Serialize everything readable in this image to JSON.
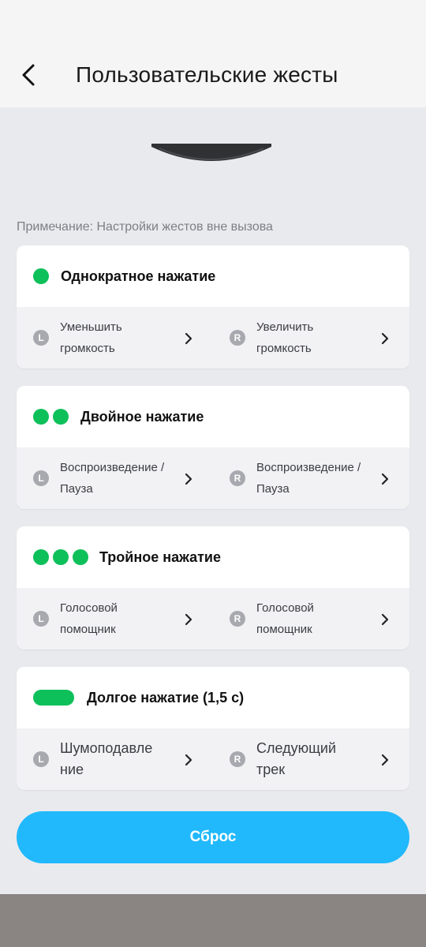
{
  "header": {
    "title": "Пользовательские жесты"
  },
  "note": "Примечание: Настройки жестов вне вызова",
  "gestures": [
    {
      "title": "Однократное нажатие",
      "dots": 1,
      "left_badge": "L",
      "left_action": "Уменьшить громкость",
      "right_badge": "R",
      "right_action": "Увеличить громкость"
    },
    {
      "title": "Двойное нажатие",
      "dots": 2,
      "left_badge": "L",
      "left_action": "Воспроизведение /Пауза",
      "right_badge": "R",
      "right_action": "Воспроизведение /Пауза"
    },
    {
      "title": "Тройное нажатие",
      "dots": 3,
      "left_badge": "L",
      "left_action": "Голосовой помощник",
      "right_badge": "R",
      "right_action": "Голосовой помощник"
    },
    {
      "title": "Долгое нажатие (1,5 с)",
      "dots": "long",
      "left_badge": "L",
      "left_action": "Шумоподавле ние",
      "right_badge": "R",
      "right_action": "Следующий трек"
    }
  ],
  "reset_label": "Сброс",
  "colors": {
    "accent_green": "#0ec05a",
    "button_blue": "#21b9fb",
    "background": "#e9eaee"
  }
}
